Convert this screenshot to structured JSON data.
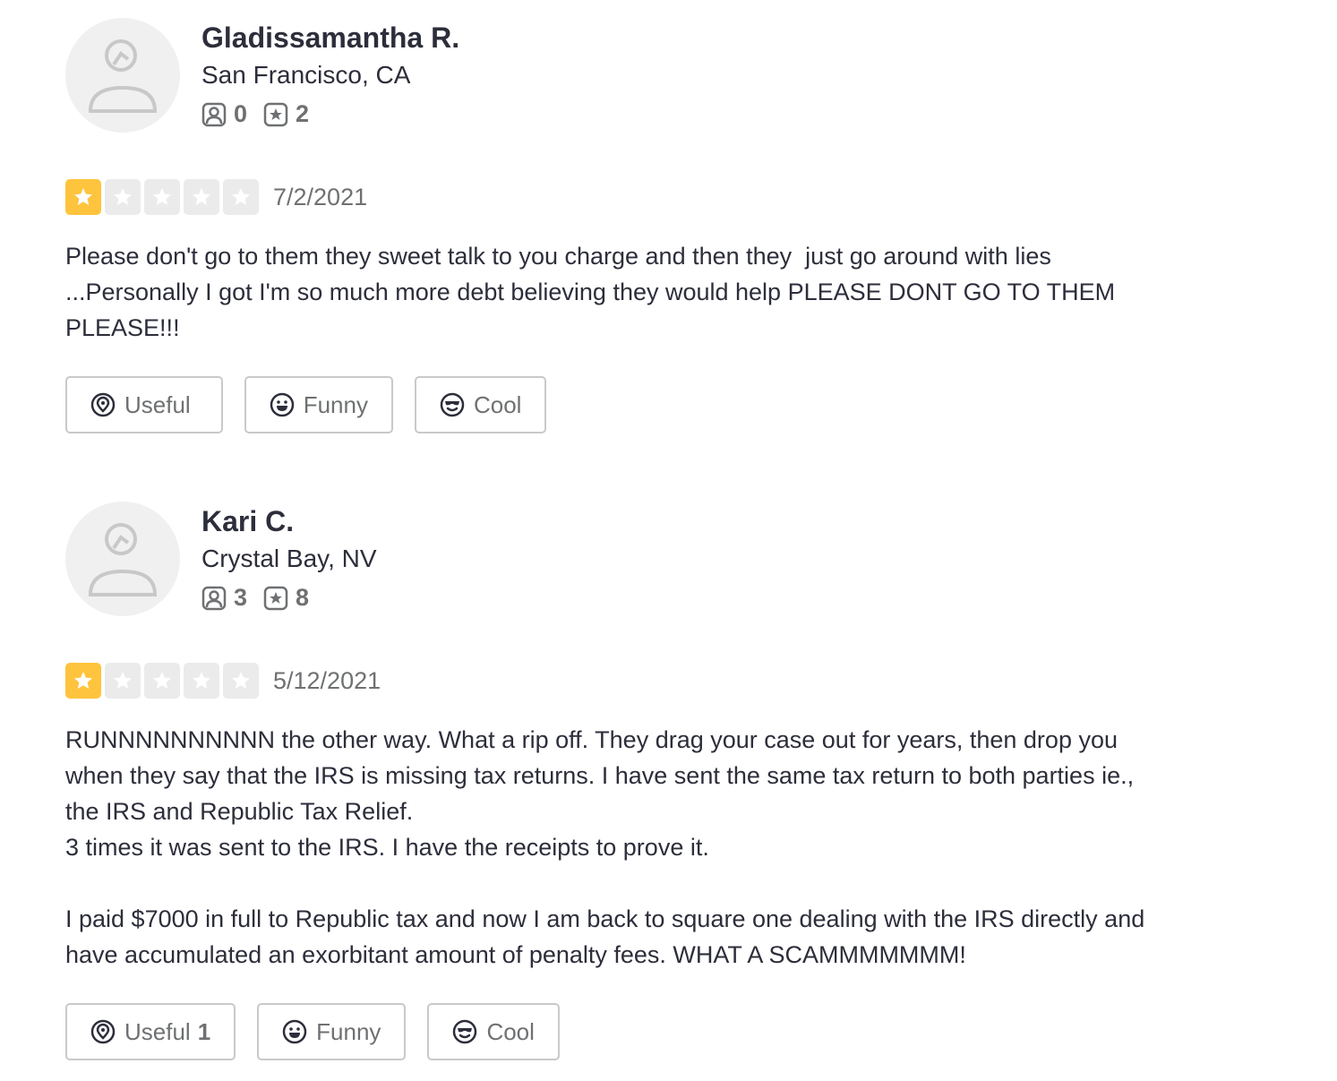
{
  "reviews": [
    {
      "user": {
        "name": "Gladissamantha R.",
        "location": "San Francisco, CA",
        "friends": "0",
        "reviews": "2"
      },
      "rating": 1,
      "date": "7/2/2021",
      "text": "Please don't go to them they sweet talk to you charge and then they  just go around with lies\n...Personally I got I'm so much more debt believing they would help PLEASE DONT GO TO THEM\nPLEASE!!!",
      "actions": {
        "useful": "Useful",
        "useful_count": "",
        "funny": "Funny",
        "cool": "Cool"
      }
    },
    {
      "user": {
        "name": "Kari C.",
        "location": "Crystal Bay, NV",
        "friends": "3",
        "reviews": "8"
      },
      "rating": 1,
      "date": "5/12/2021",
      "text": "RUNNNNNNNNNN the other way. What a rip off. They drag your case out for years, then drop you\nwhen they say that the IRS is missing tax returns. I have sent the same tax return to both parties ie.,\nthe IRS and Republic Tax Relief.\n3 times it was sent to the IRS. I have the receipts to prove it.\n\nI paid $7000 in full to Republic tax and now I am back to square one dealing with the IRS directly and\nhave accumulated an exorbitant amount of penalty fees. WHAT A SCAMMMMMMM!",
      "actions": {
        "useful": "Useful",
        "useful_count": "1",
        "funny": "Funny",
        "cool": "Cool"
      }
    }
  ],
  "colors": {
    "star_on": "#ffc43d",
    "star_off": "#ebebeb",
    "text": "#2d2e3b",
    "muted": "#6e7072"
  },
  "icons": [
    "avatar-placeholder-icon",
    "friends-icon",
    "review-count-icon",
    "star-icon",
    "useful-icon",
    "funny-icon",
    "cool-icon"
  ]
}
